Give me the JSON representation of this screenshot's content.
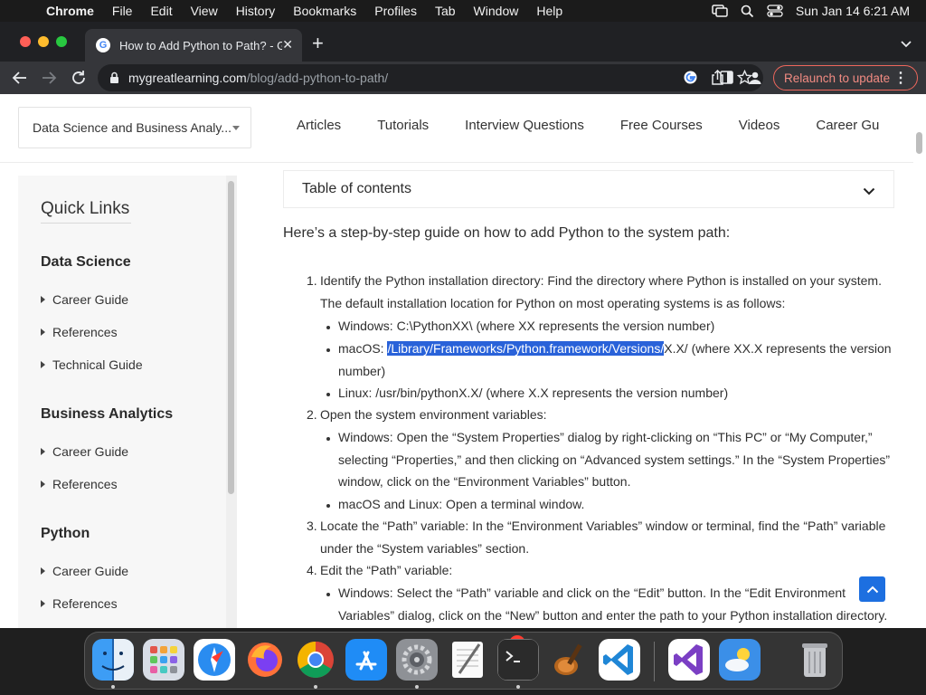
{
  "menubar": {
    "app": "Chrome",
    "items": [
      "File",
      "Edit",
      "View",
      "History",
      "Bookmarks",
      "Profiles",
      "Tab",
      "Window",
      "Help"
    ],
    "clock": "Sun Jan 14  6:21 AM"
  },
  "browser": {
    "tab_title": "How to Add Python to Path? - G",
    "favicon_letter": "G",
    "url_host": "mygreatlearning.com",
    "url_path": "/blog/add-python-to-path/",
    "relaunch_label": "Relaunch to update"
  },
  "site": {
    "category_select": "Data Science and Business Analy...",
    "nav": [
      "Articles",
      "Tutorials",
      "Interview Questions",
      "Free Courses",
      "Videos",
      "Career Gu"
    ]
  },
  "sidebar": {
    "title": "Quick Links",
    "sections": [
      {
        "name": "Data Science",
        "items": [
          "Career Guide",
          "References",
          "Technical Guide"
        ]
      },
      {
        "name": "Business Analytics",
        "items": [
          "Career Guide",
          "References"
        ]
      },
      {
        "name": "Python",
        "items": [
          "Career Guide",
          "References"
        ]
      }
    ]
  },
  "article": {
    "toc_label": "Table of contents",
    "intro": "Here’s a step-by-step guide on how to add Python to the system path:",
    "steps": [
      {
        "num": "1.",
        "text": "Identify the Python installation directory: Find the directory where Python is installed on your system. The default installation location for Python on most operating systems is as follows:",
        "bullets": [
          "Windows: C:\\PythonXX\\ (where XX represents the version number)",
          "macOS: ",
          "Linux: /usr/bin/pythonX.X/ (where X.X represents the version number)"
        ],
        "mac_selected": "/Library/Frameworks/Python.framework/Versions/",
        "mac_rest": "X.X/ (where XX.X represents the version number)"
      },
      {
        "num": "2.",
        "text": "Open the system environment variables:",
        "bullets": [
          "Windows: Open the “System Properties” dialog by right-clicking on “This PC” or “My Computer,” selecting “Properties,” and then clicking on “Advanced system settings.” In the “System Properties” window, click on the “Environment Variables” button.",
          "macOS and Linux: Open a terminal window."
        ]
      },
      {
        "num": "3.",
        "text": "Locate the “Path” variable: In the “Environment Variables” window or terminal, find the “Path” variable under the “System variables” section."
      },
      {
        "num": "4.",
        "text": "Edit the “Path” variable:",
        "bullets": [
          "Windows: Select the “Path” variable and click on the “Edit” button. In the “Edit Environment Variables” dialog, click on the “New” button and enter the path to your Python installation directory. Click “OK” to"
        ]
      }
    ]
  },
  "dock": {
    "apps": [
      "Finder",
      "Launchpad",
      "Safari",
      "Firefox",
      "Chrome",
      "App Store",
      "System Settings",
      "TextEdit",
      "Terminal",
      "Instruments",
      "Visual Studio Code",
      "Visual Studio",
      "Weather",
      "Trash"
    ],
    "badge_count": "1"
  }
}
